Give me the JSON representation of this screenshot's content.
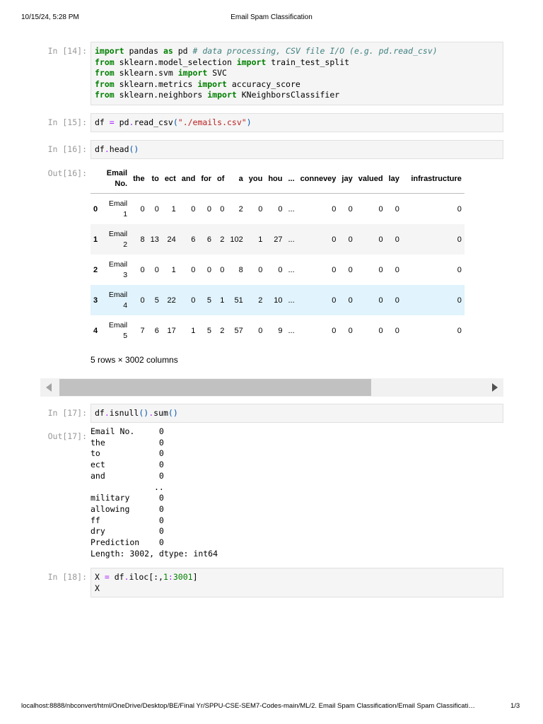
{
  "header": {
    "datetime": "10/15/24, 5:28 PM",
    "title": "Email Spam Classification"
  },
  "footer": {
    "url": "localhost:8888/nbconvert/html/OneDrive/Desktop/BE/Final Yr/SPPU-CSE-SEM7-Codes-main/ML/2. Email Spam Classification/Email Spam Classificati…",
    "page": "1/3"
  },
  "cells": [
    {
      "prompt": "In [14]:",
      "lines": [
        [
          {
            "t": "import",
            "c": "k"
          },
          {
            "t": " pandas "
          },
          {
            "t": "as",
            "c": "k"
          },
          {
            "t": " pd "
          },
          {
            "t": "# data processing, CSV file I/O (e.g. pd.read_csv)",
            "c": "c"
          }
        ],
        [
          {
            "t": "from",
            "c": "k"
          },
          {
            "t": " sklearn.model_selection "
          },
          {
            "t": "import",
            "c": "k"
          },
          {
            "t": " train_test_split"
          }
        ],
        [
          {
            "t": "from",
            "c": "k"
          },
          {
            "t": " sklearn.svm "
          },
          {
            "t": "import",
            "c": "k"
          },
          {
            "t": " SVC"
          }
        ],
        [
          {
            "t": "from",
            "c": "k"
          },
          {
            "t": " sklearn.metrics "
          },
          {
            "t": "import",
            "c": "k"
          },
          {
            "t": " accuracy_score"
          }
        ],
        [
          {
            "t": "from",
            "c": "k"
          },
          {
            "t": " sklearn.neighbors "
          },
          {
            "t": "import",
            "c": "k"
          },
          {
            "t": " KNeighborsClassifier"
          }
        ]
      ]
    },
    {
      "prompt": "In [15]:",
      "lines": [
        [
          {
            "t": "df "
          },
          {
            "t": "=",
            "c": "o"
          },
          {
            "t": " pd"
          },
          {
            "t": ".",
            "c": "o"
          },
          {
            "t": "read_csv"
          },
          {
            "t": "(",
            "c": "p"
          },
          {
            "t": "\"./emails.csv\"",
            "c": "s"
          },
          {
            "t": ")",
            "c": "p"
          }
        ]
      ]
    },
    {
      "prompt": "In [16]:",
      "lines": [
        [
          {
            "t": "df"
          },
          {
            "t": ".",
            "c": "o"
          },
          {
            "t": "head"
          },
          {
            "t": "()",
            "c": "p"
          }
        ]
      ]
    },
    {
      "prompt": "In [17]:",
      "lines": [
        [
          {
            "t": "df"
          },
          {
            "t": ".",
            "c": "o"
          },
          {
            "t": "isnull"
          },
          {
            "t": "()",
            "c": "p"
          },
          {
            "t": ".",
            "c": "o"
          },
          {
            "t": "sum"
          },
          {
            "t": "()",
            "c": "p"
          }
        ]
      ]
    },
    {
      "prompt": "In [18]:",
      "lines": [
        [
          {
            "t": "X "
          },
          {
            "t": "=",
            "c": "o"
          },
          {
            "t": " df"
          },
          {
            "t": ".",
            "c": "o"
          },
          {
            "t": "iloc[:,"
          },
          {
            "t": "1",
            "c": "n"
          },
          {
            "t": ":",
            "c": "o"
          },
          {
            "t": "3001",
            "c": "n"
          },
          {
            "t": "]"
          }
        ],
        [
          {
            "t": "X"
          }
        ]
      ]
    }
  ],
  "out16": {
    "prompt": "Out[16]:",
    "columns": [
      "Email No.",
      "the",
      "to",
      "ect",
      "and",
      "for",
      "of",
      "a",
      "you",
      "hou",
      "...",
      "connevey",
      "jay",
      "valued",
      "lay",
      "infrastructure"
    ],
    "rows": [
      {
        "index": "0",
        "values": [
          "Email 1",
          "0",
          "0",
          "1",
          "0",
          "0",
          "0",
          "2",
          "0",
          "0",
          "...",
          "0",
          "0",
          "0",
          "0",
          "0"
        ]
      },
      {
        "index": "1",
        "values": [
          "Email 2",
          "8",
          "13",
          "24",
          "6",
          "6",
          "2",
          "102",
          "1",
          "27",
          "...",
          "0",
          "0",
          "0",
          "0",
          "0"
        ]
      },
      {
        "index": "2",
        "values": [
          "Email 3",
          "0",
          "0",
          "1",
          "0",
          "0",
          "0",
          "8",
          "0",
          "0",
          "...",
          "0",
          "0",
          "0",
          "0",
          "0"
        ]
      },
      {
        "index": "3",
        "values": [
          "Email 4",
          "0",
          "5",
          "22",
          "0",
          "5",
          "1",
          "51",
          "2",
          "10",
          "...",
          "0",
          "0",
          "0",
          "0",
          "0"
        ]
      },
      {
        "index": "4",
        "values": [
          "Email 5",
          "7",
          "6",
          "17",
          "1",
          "5",
          "2",
          "57",
          "0",
          "9",
          "...",
          "0",
          "0",
          "0",
          "0",
          "0"
        ]
      }
    ],
    "shape": "5 rows × 3002 columns"
  },
  "out17": {
    "prompt": "Out[17]:",
    "text": "Email No.     0\nthe           0\nto            0\nect           0\nand           0\n             ..\nmilitary      0\nallowing      0\nff            0\ndry           0\nPrediction    0\nLength: 3002, dtype: int64"
  }
}
